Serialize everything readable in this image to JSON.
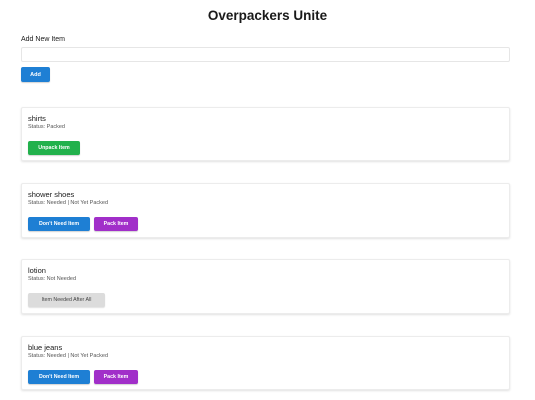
{
  "app": {
    "title": "Overpackers Unite"
  },
  "add_form": {
    "label": "Add New Item",
    "input_value": "",
    "input_placeholder": "",
    "button_label": "Add"
  },
  "items": [
    {
      "name": "shirts",
      "status": "Status: Packed",
      "buttons": [
        "Unpack Item"
      ]
    },
    {
      "name": "shower shoes",
      "status": "Status: Needed | Not Yet Packed",
      "buttons": [
        "Don't Need Item",
        "Pack Item"
      ]
    },
    {
      "name": "lotion",
      "status": "Status: Not Needed",
      "buttons": [
        "Item Needed After All"
      ]
    },
    {
      "name": "blue jeans",
      "status": "Status: Needed | Not Yet Packed",
      "buttons": [
        "Don't Need Item",
        "Pack Item"
      ]
    }
  ],
  "colors": {
    "primary_blue": "#1e7fd4",
    "success_green": "#22b14c",
    "pack_purple": "#a12fc9",
    "neutral_gray": "#dcdcdc"
  }
}
